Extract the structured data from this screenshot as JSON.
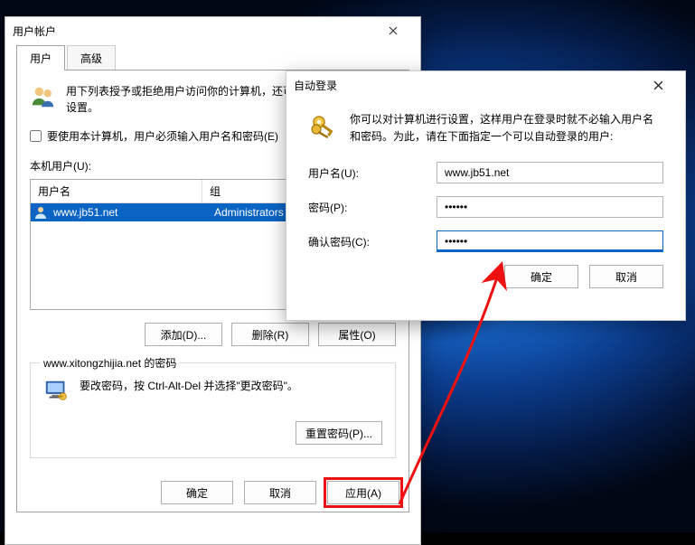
{
  "main": {
    "title": "用户帐户",
    "tabs": {
      "users": "用户",
      "advanced": "高级"
    },
    "intro": "用下列表授予或拒绝用户访问你的计算机，还可以更改其密码和其他设置。",
    "checkbox_label": "要使用本计算机，用户必须输入用户名和密码(E)",
    "list_label": "本机用户(U):",
    "columns": {
      "name": "用户名",
      "group": "组"
    },
    "rows": [
      {
        "name": "www.jb51.net",
        "group": "Administrators"
      }
    ],
    "buttons": {
      "add": "添加(D)...",
      "remove": "删除(R)",
      "props": "属性(O)"
    },
    "pw_group_title": "www.xitongzhijia.net 的密码",
    "pw_text": "要改密码，按 Ctrl-Alt-Del 并选择\"更改密码\"。",
    "reset_pw": "重置密码(P)...",
    "footer": {
      "ok": "确定",
      "cancel": "取消",
      "apply": "应用(A)"
    }
  },
  "dlg": {
    "title": "自动登录",
    "intro": "你可以对计算机进行设置，这样用户在登录时就不必输入用户名和密码。为此，请在下面指定一个可以自动登录的用户:",
    "labels": {
      "user": "用户名(U):",
      "pw": "密码(P):",
      "confirm": "确认密码(C):"
    },
    "values": {
      "user": "www.jb51.net",
      "pw": "••••••",
      "confirm": "••••••"
    },
    "buttons": {
      "ok": "确定",
      "cancel": "取消"
    }
  }
}
